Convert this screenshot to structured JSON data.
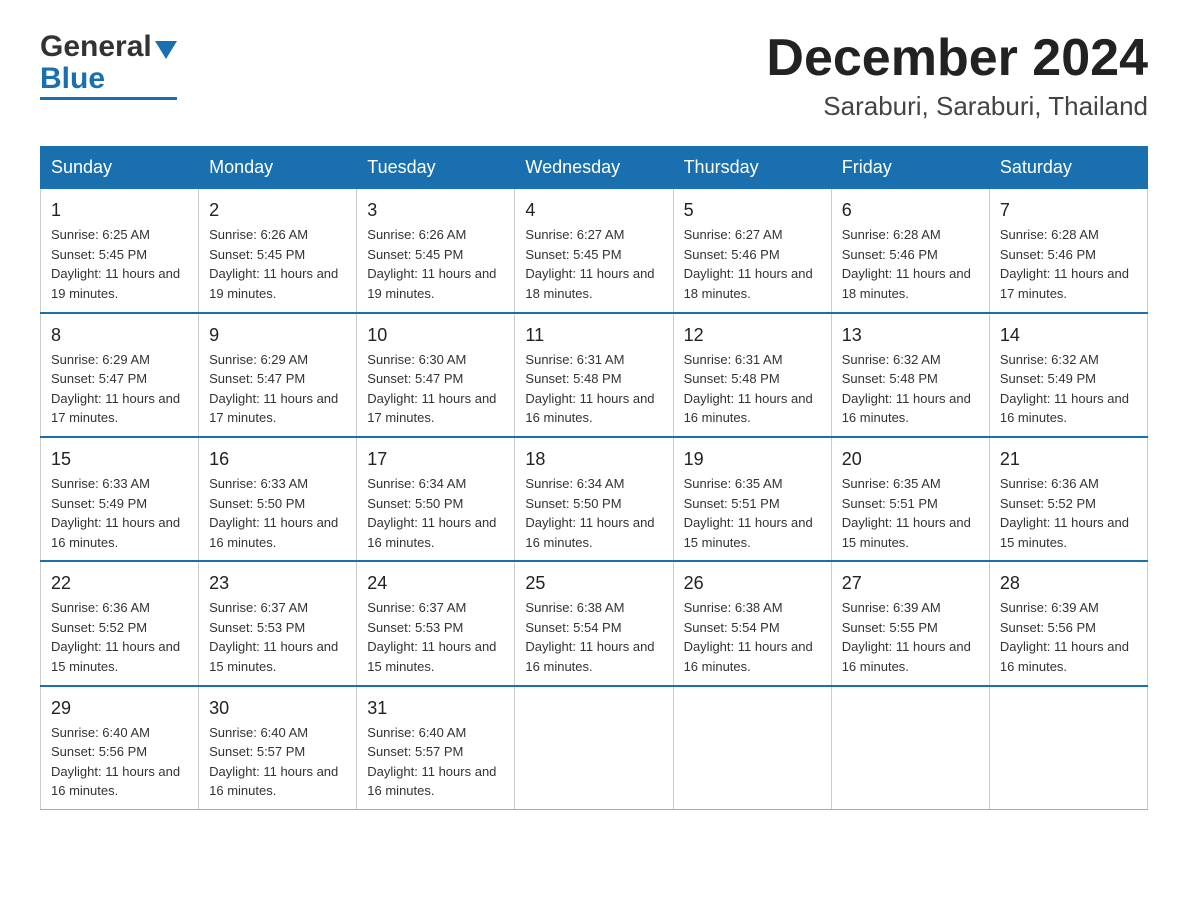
{
  "header": {
    "logo_general": "General",
    "logo_blue": "Blue",
    "calendar_title": "December 2024",
    "calendar_subtitle": "Saraburi, Saraburi, Thailand"
  },
  "days_of_week": [
    "Sunday",
    "Monday",
    "Tuesday",
    "Wednesday",
    "Thursday",
    "Friday",
    "Saturday"
  ],
  "weeks": [
    [
      {
        "day": "1",
        "sunrise": "6:25 AM",
        "sunset": "5:45 PM",
        "daylight": "11 hours and 19 minutes."
      },
      {
        "day": "2",
        "sunrise": "6:26 AM",
        "sunset": "5:45 PM",
        "daylight": "11 hours and 19 minutes."
      },
      {
        "day": "3",
        "sunrise": "6:26 AM",
        "sunset": "5:45 PM",
        "daylight": "11 hours and 19 minutes."
      },
      {
        "day": "4",
        "sunrise": "6:27 AM",
        "sunset": "5:45 PM",
        "daylight": "11 hours and 18 minutes."
      },
      {
        "day": "5",
        "sunrise": "6:27 AM",
        "sunset": "5:46 PM",
        "daylight": "11 hours and 18 minutes."
      },
      {
        "day": "6",
        "sunrise": "6:28 AM",
        "sunset": "5:46 PM",
        "daylight": "11 hours and 18 minutes."
      },
      {
        "day": "7",
        "sunrise": "6:28 AM",
        "sunset": "5:46 PM",
        "daylight": "11 hours and 17 minutes."
      }
    ],
    [
      {
        "day": "8",
        "sunrise": "6:29 AM",
        "sunset": "5:47 PM",
        "daylight": "11 hours and 17 minutes."
      },
      {
        "day": "9",
        "sunrise": "6:29 AM",
        "sunset": "5:47 PM",
        "daylight": "11 hours and 17 minutes."
      },
      {
        "day": "10",
        "sunrise": "6:30 AM",
        "sunset": "5:47 PM",
        "daylight": "11 hours and 17 minutes."
      },
      {
        "day": "11",
        "sunrise": "6:31 AM",
        "sunset": "5:48 PM",
        "daylight": "11 hours and 16 minutes."
      },
      {
        "day": "12",
        "sunrise": "6:31 AM",
        "sunset": "5:48 PM",
        "daylight": "11 hours and 16 minutes."
      },
      {
        "day": "13",
        "sunrise": "6:32 AM",
        "sunset": "5:48 PM",
        "daylight": "11 hours and 16 minutes."
      },
      {
        "day": "14",
        "sunrise": "6:32 AM",
        "sunset": "5:49 PM",
        "daylight": "11 hours and 16 minutes."
      }
    ],
    [
      {
        "day": "15",
        "sunrise": "6:33 AM",
        "sunset": "5:49 PM",
        "daylight": "11 hours and 16 minutes."
      },
      {
        "day": "16",
        "sunrise": "6:33 AM",
        "sunset": "5:50 PM",
        "daylight": "11 hours and 16 minutes."
      },
      {
        "day": "17",
        "sunrise": "6:34 AM",
        "sunset": "5:50 PM",
        "daylight": "11 hours and 16 minutes."
      },
      {
        "day": "18",
        "sunrise": "6:34 AM",
        "sunset": "5:50 PM",
        "daylight": "11 hours and 16 minutes."
      },
      {
        "day": "19",
        "sunrise": "6:35 AM",
        "sunset": "5:51 PM",
        "daylight": "11 hours and 15 minutes."
      },
      {
        "day": "20",
        "sunrise": "6:35 AM",
        "sunset": "5:51 PM",
        "daylight": "11 hours and 15 minutes."
      },
      {
        "day": "21",
        "sunrise": "6:36 AM",
        "sunset": "5:52 PM",
        "daylight": "11 hours and 15 minutes."
      }
    ],
    [
      {
        "day": "22",
        "sunrise": "6:36 AM",
        "sunset": "5:52 PM",
        "daylight": "11 hours and 15 minutes."
      },
      {
        "day": "23",
        "sunrise": "6:37 AM",
        "sunset": "5:53 PM",
        "daylight": "11 hours and 15 minutes."
      },
      {
        "day": "24",
        "sunrise": "6:37 AM",
        "sunset": "5:53 PM",
        "daylight": "11 hours and 15 minutes."
      },
      {
        "day": "25",
        "sunrise": "6:38 AM",
        "sunset": "5:54 PM",
        "daylight": "11 hours and 16 minutes."
      },
      {
        "day": "26",
        "sunrise": "6:38 AM",
        "sunset": "5:54 PM",
        "daylight": "11 hours and 16 minutes."
      },
      {
        "day": "27",
        "sunrise": "6:39 AM",
        "sunset": "5:55 PM",
        "daylight": "11 hours and 16 minutes."
      },
      {
        "day": "28",
        "sunrise": "6:39 AM",
        "sunset": "5:56 PM",
        "daylight": "11 hours and 16 minutes."
      }
    ],
    [
      {
        "day": "29",
        "sunrise": "6:40 AM",
        "sunset": "5:56 PM",
        "daylight": "11 hours and 16 minutes."
      },
      {
        "day": "30",
        "sunrise": "6:40 AM",
        "sunset": "5:57 PM",
        "daylight": "11 hours and 16 minutes."
      },
      {
        "day": "31",
        "sunrise": "6:40 AM",
        "sunset": "5:57 PM",
        "daylight": "11 hours and 16 minutes."
      },
      null,
      null,
      null,
      null
    ]
  ]
}
